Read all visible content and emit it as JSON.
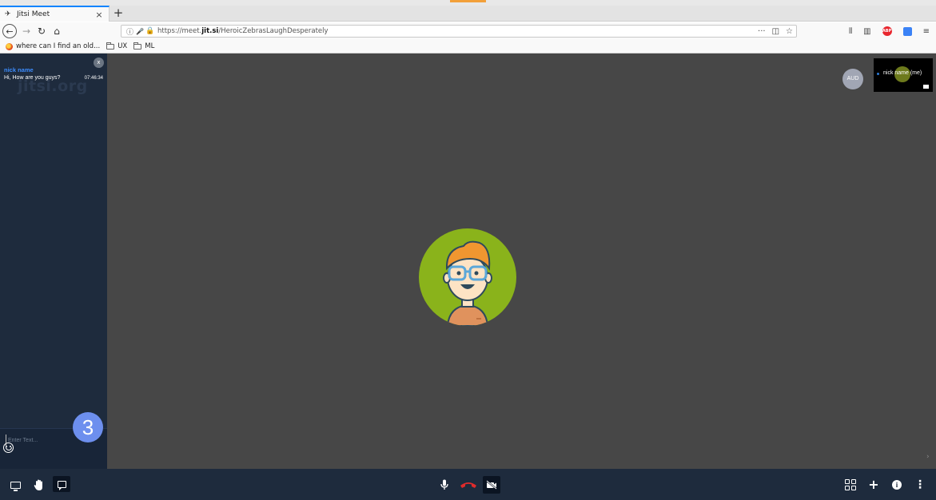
{
  "browser": {
    "tab_title": "Jitsi Meet",
    "tab_close": "×",
    "new_tab": "+",
    "url_prefix": "https://meet.",
    "url_domain": "jit.si",
    "url_path": "/HeroicZebrasLaughDesperately",
    "page_actions": "···",
    "bookmarks": [
      {
        "label": "where can I find an old...",
        "icon": "firefox-icon"
      },
      {
        "label": "UX",
        "icon": "folder-icon"
      },
      {
        "label": "ML",
        "icon": "folder-icon"
      }
    ],
    "abp_label": "ABP"
  },
  "chat": {
    "watermark": "jitsi.org",
    "close_label": "x",
    "messages": [
      {
        "name": "nick name",
        "text": "Hi, How are you guys?",
        "time": "07:46:34"
      }
    ],
    "input_placeholder": "Enter Text..."
  },
  "stage": {
    "audio_badge": "AUD",
    "thumbnail_name": "nick name (me)"
  },
  "toolbar": {
    "chat_badge_count": "3"
  },
  "colors": {
    "app_background": "#474747",
    "panel_background": "#1e2b3d",
    "avatar_background": "#8ab31b",
    "chat_name": "#3d8dff",
    "badge": "#6d8fee",
    "hangup": "#e02b2b"
  }
}
